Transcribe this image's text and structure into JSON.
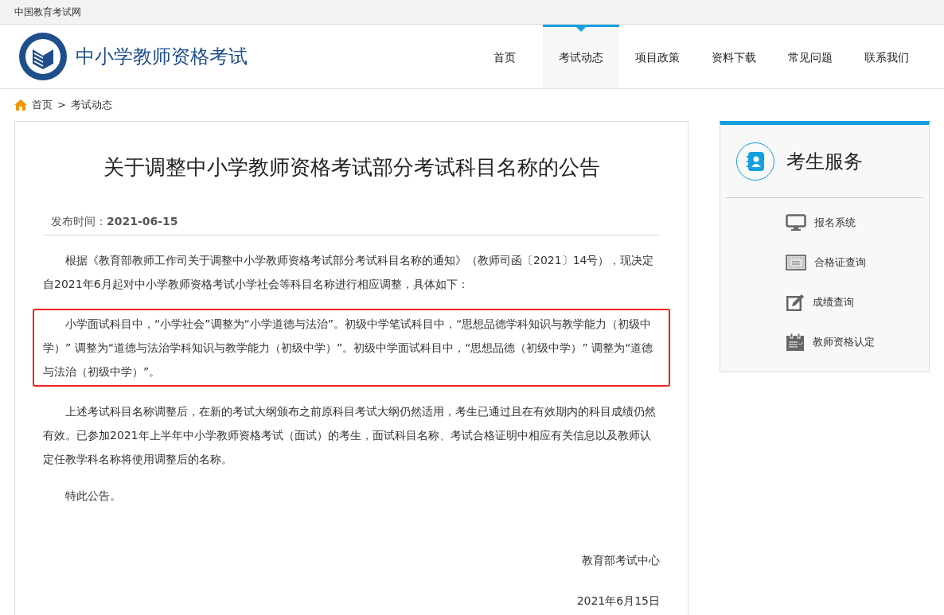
{
  "top_bar": {
    "site_name": "中国教育考试网"
  },
  "header": {
    "title": "中小学教师资格考试",
    "nav": [
      {
        "label": "首页",
        "selected": false
      },
      {
        "label": "考试动态",
        "selected": true
      },
      {
        "label": "项目政策",
        "selected": false
      },
      {
        "label": "资料下载",
        "selected": false
      },
      {
        "label": "常见问题",
        "selected": false
      },
      {
        "label": "联系我们",
        "selected": false
      }
    ]
  },
  "breadcrumb": [
    "首页",
    "考试动态"
  ],
  "breadcrumb_separator": ">",
  "article": {
    "title": "关于调整中小学教师资格考试部分考试科目名称的公告",
    "publish_info": "发布时间：**2021-06-15**",
    "paragraphs": [
      {
        "text": "根据《教育部教师工作司关于调整中小学教师资格考试部分考试科目名称的通知》（教师司函〔2021〕14号），现决定自2021年6月起对中小学教师资格考试小学社会等科目名称进行相应调整，具体如下：",
        "highlighted": false
      },
      {
        "text": "小学面试科目中，“小学社会”调整为“小学道德与法治”。初级中学笔试科目中，“思想品德学科知识与教学能力（初级中学）” 调整为“道德与法治学科知识与教学能力（初级中学）”。初级中学面试科目中，“思想品德（初级中学）” 调整为“道德与法治（初级中学）”。",
        "highlighted": true
      },
      {
        "text": "上述考试科目名称调整后，在新的考试大纲颁布之前原科目考试大纲仍然适用，考生已通过且在有效期内的科目成绩仍然有效。已参加2021年上半年中小学教师资格考试（面试）的考生，面试科目名称、考试合格证明中相应有关信息以及教师认定任教学科名称将使用调整后的名称。",
        "highlighted": false
      },
      {
        "text": "特此公告。",
        "highlighted": false
      }
    ],
    "signature": "教育部考试中心",
    "date": "2021年6月15日"
  },
  "sidebar": {
    "title": "考生服务",
    "items": [
      {
        "kind": "monitor",
        "label": "报名系统"
      },
      {
        "kind": "certificate",
        "label": "合格证查询"
      },
      {
        "kind": "edit",
        "label": "成绩查询"
      },
      {
        "kind": "calendar",
        "label": "教师资格认定"
      }
    ]
  }
}
